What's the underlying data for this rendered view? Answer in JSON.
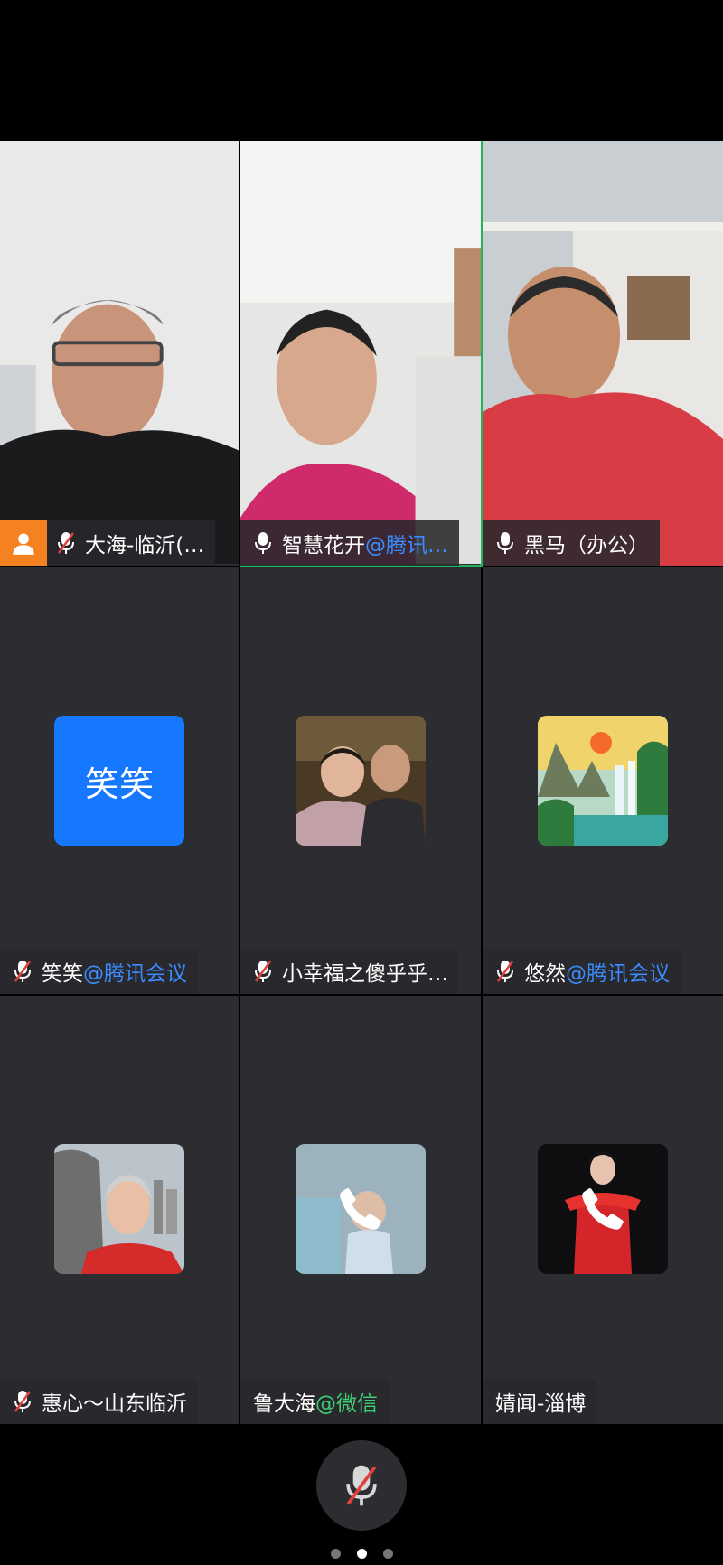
{
  "participants": [
    {
      "name": "大海-临沂(…",
      "suffix": "",
      "mic": "muted",
      "host": true
    },
    {
      "name": "智慧花开",
      "suffix": "@腾讯…",
      "mic": "on",
      "active": true
    },
    {
      "name": "黑马（办公）",
      "suffix": "",
      "mic": "on"
    },
    {
      "name": "笑笑",
      "suffix": "@腾讯会议",
      "mic": "muted",
      "avatar_text": "笑笑"
    },
    {
      "name": "小幸福之傻乎乎…",
      "suffix": "",
      "mic": "muted"
    },
    {
      "name": "悠然",
      "suffix": "@腾讯会议",
      "mic": "muted"
    },
    {
      "name": "惠心～山东临沂",
      "suffix": "",
      "mic": "muted"
    },
    {
      "name": "鲁大海",
      "suffix": "@微信",
      "mic": "none",
      "phone": true
    },
    {
      "name": "婧闻-淄博",
      "suffix": "",
      "mic": "none",
      "phone": true
    }
  ],
  "colors": {
    "active_border": "#21b35a",
    "host_badge": "#f58220",
    "suffix_tencent": "#3b8cff",
    "suffix_wechat": "#3ecf72",
    "avatar_blue": "#1677ff"
  },
  "pager": {
    "current": 2,
    "total": 3
  }
}
